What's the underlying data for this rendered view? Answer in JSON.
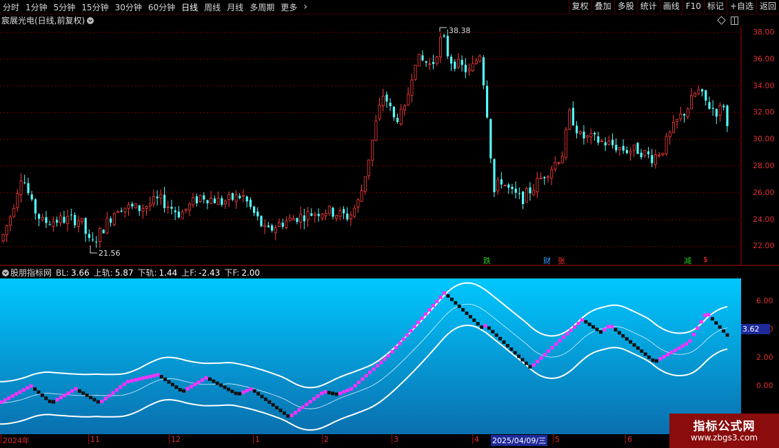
{
  "toolbar": {
    "periods": [
      "分时",
      "1分钟",
      "5分钟",
      "15分钟",
      "30分钟",
      "60分钟",
      "日线",
      "周线",
      "月线",
      "多周期",
      "更多"
    ],
    "active_period": "日线",
    "right_buttons": [
      "复权",
      "叠加",
      "多股",
      "统计",
      "画线",
      "F10",
      "标记",
      "+自选",
      "返回"
    ]
  },
  "main_chart": {
    "title": "宸展光电(日线,前复权)",
    "y_axis_labels": [
      "38.00",
      "36.00",
      "34.00",
      "32.00",
      "30.00",
      "28.00",
      "26.00",
      "24.00",
      "22.00"
    ],
    "high_marker": "38.38",
    "low_marker": "21.56",
    "events": [
      {
        "text": "跌",
        "color": "#22cc22"
      },
      {
        "text": "财",
        "color": "#3399ff"
      },
      {
        "text": "张",
        "color": "#ff3333"
      },
      {
        "text": "减",
        "color": "#22cc22"
      },
      {
        "text": "$",
        "color": "#ff3333"
      }
    ],
    "colors": {
      "up": "#ff3c3c",
      "down": "#54ffff",
      "grid": "#7a0000"
    }
  },
  "indicator": {
    "name": "股朋指标网",
    "params": [
      {
        "label": "BL:",
        "value": "3.66",
        "color": "#ffffff"
      },
      {
        "label": "上轨:",
        "value": "5.87",
        "color": "#ffffff"
      },
      {
        "label": "下轨:",
        "value": "1.44",
        "color": "#ffffff"
      },
      {
        "label": "上F:",
        "value": "-2.43",
        "color": "#ffffff"
      },
      {
        "label": "下F:",
        "value": "2.00",
        "color": "#ffffff"
      }
    ],
    "y_axis_labels": [
      "6.00",
      "4.00",
      "2.00",
      "0.00"
    ],
    "current_value": "3.62",
    "colors": {
      "bg_top": "#00c8ff",
      "bg_bottom": "#0a6fae",
      "band": "#ffffff",
      "up_block": "#ff30ff",
      "down_block": "#111111"
    }
  },
  "date_axis": {
    "labels": [
      "2024年",
      "11",
      "12",
      "1",
      "2",
      "3",
      "4",
      "5",
      "6"
    ],
    "highlight": "2025/04/09/三"
  },
  "watermark": {
    "line1": "指标公式网",
    "line2": "www.zbgs3.com"
  }
}
